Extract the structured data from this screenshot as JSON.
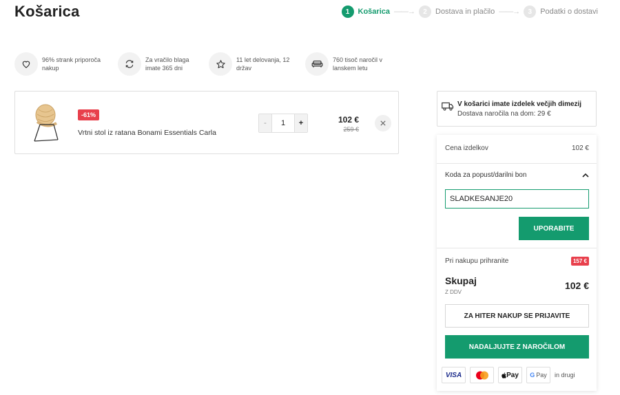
{
  "page": {
    "title": "Košarica"
  },
  "steps": [
    {
      "number": "1",
      "label": "Košarica"
    },
    {
      "number": "2",
      "label": "Dostava in plačilo"
    },
    {
      "number": "3",
      "label": "Podatki o dostavi"
    }
  ],
  "step_arrow": "——→",
  "benefits": [
    {
      "icon": "heart-icon",
      "text": "96% strank priporoča nakup"
    },
    {
      "icon": "return-icon",
      "text": "Za vračilo blaga imate 365 dni"
    },
    {
      "icon": "star-icon",
      "text": "11 let delovanja, 12 držav"
    },
    {
      "icon": "sofa-icon",
      "text": "760 tisoč naročil v lanskem letu"
    }
  ],
  "cart_item": {
    "discount": "-61%",
    "name": "Vrtni stol iz ratana Bonami Essentials Carla",
    "quantity": "1",
    "qty_minus": "-",
    "qty_plus": "+",
    "price": "102 €",
    "old_price": "259 €"
  },
  "shipping": {
    "title": "V košarici imate izdelek večjih dimezij",
    "subtitle": "Dostava naročila na dom: 29 €"
  },
  "summary": {
    "items_label": "Cena izdelkov",
    "items_value": "102 €",
    "coupon_label": "Koda za popust/darilni bon",
    "coupon_value": "SLADKESANJE20",
    "apply_label": "UPORABITE",
    "savings_label": "Pri nakupu prihranite",
    "savings_value": "157 €",
    "total_label": "Skupaj",
    "vat_label": "Z DDV",
    "total_value": "102 €",
    "login_label": "ZA HITER NAKUP SE PRIJAVITE",
    "continue_label": "NADALJUJTE Z NAROČILOM"
  },
  "payments": {
    "visa": "VISA",
    "apple": "Pay",
    "google": "Pay",
    "more": "in drugi"
  },
  "colors": {
    "accent": "#149b6e",
    "sale": "#e8404c"
  }
}
